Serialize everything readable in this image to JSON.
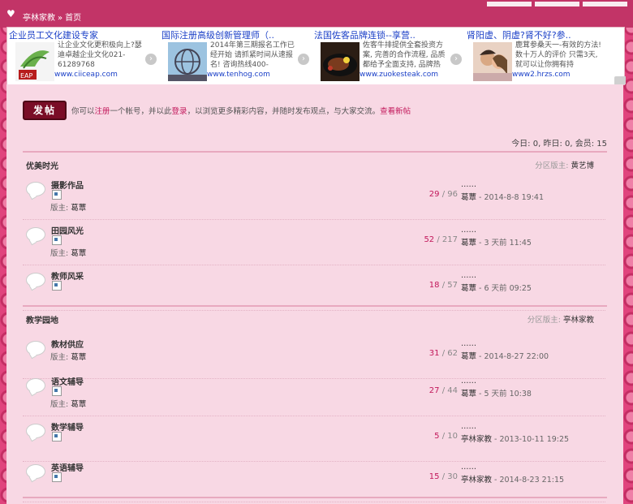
{
  "breadcrumb": {
    "site": "亭林家教",
    "separator": "»",
    "current": "首页"
  },
  "ads": [
    {
      "title": "企业员工文化建设专家",
      "desc": "让企业文化更积极向上?瑟迪卓越企业文化021-61289768",
      "url": "www.ciiceap.com",
      "thumb_label": "EAP"
    },
    {
      "title": "国际注册高级创新管理师（..",
      "desc": "2014年第三期报名工作已经开始 请抓紧时间从速报名! 咨询热线400-",
      "url": "www.tenhog.com",
      "thumb_label": ""
    },
    {
      "title": "法国佐客品牌连锁--享营..",
      "desc": "佐客牛排提供全套投资方案, 完善的合作流程, 品质都给予全面支持, 品牌热",
      "url": "www.zuokesteak.com",
      "thumb_label": ""
    },
    {
      "title": "肾阳虚、阴虚?肾不好?参..",
      "desc": "鹿茸参桑天一-有效的方法!数十万人的评价 只需3天, 就可以让你拥有持",
      "url": "www2.hrzs.com",
      "thumb_label": ""
    }
  ],
  "post_button": "发帖",
  "notice": {
    "prefix": "你可以",
    "register": "注册",
    "mid1": "一个帐号，并以此",
    "login": "登录",
    "mid2": "，以浏览更多精彩内容，并随时发布观点，与大家交流。",
    "new_posts": "查看新帖"
  },
  "stats": "今日: 0, 昨日: 0, 会员: 15",
  "sections": [
    {
      "name": "优美时光",
      "mod_label": "分区版主:",
      "mod_name": "黄艺博",
      "forums": [
        {
          "name": "摄影作品",
          "owner_label": "版主:",
          "owner": "葛蕈",
          "threads": "29",
          "posts": "96",
          "last_title": "……",
          "last_user": "葛蕈",
          "last_time": "2014-8-8 19:41"
        },
        {
          "name": "田园风光",
          "owner_label": "版主:",
          "owner": "葛蕈",
          "threads": "52",
          "posts": "217",
          "last_title": "……",
          "last_user": "葛蕈",
          "last_time": "3 天前 11:45"
        },
        {
          "name": "教师风采",
          "owner_label": "",
          "owner": "",
          "threads": "18",
          "posts": "57",
          "last_title": "……",
          "last_user": "葛蕈",
          "last_time": "6 天前 09:25"
        }
      ]
    },
    {
      "name": "教学园地",
      "mod_label": "分区版主:",
      "mod_name": "亭林家教",
      "forums": [
        {
          "name": "教材供应",
          "owner_label": "版主:",
          "owner": "葛蕈",
          "threads": "31",
          "posts": "62",
          "last_title": "……",
          "last_user": "葛蕈",
          "last_time": "2014-8-27 22:00"
        },
        {
          "name": "语文辅导",
          "owner_label": "版主:",
          "owner": "葛蕈",
          "threads": "27",
          "posts": "44",
          "last_title": "……",
          "last_user": "葛蕈",
          "last_time": "5 天前 10:38"
        },
        {
          "name": "数学辅导",
          "owner_label": "",
          "owner": "",
          "threads": "5",
          "posts": "10",
          "last_title": "……",
          "last_user": "亭林家教",
          "last_time": "2013-10-11 19:25"
        },
        {
          "name": "英语辅导",
          "owner_label": "",
          "owner": "",
          "threads": "15",
          "posts": "30",
          "last_title": "……",
          "last_user": "亭林家教",
          "last_time": "2014-8-23 21:15"
        }
      ]
    }
  ]
}
